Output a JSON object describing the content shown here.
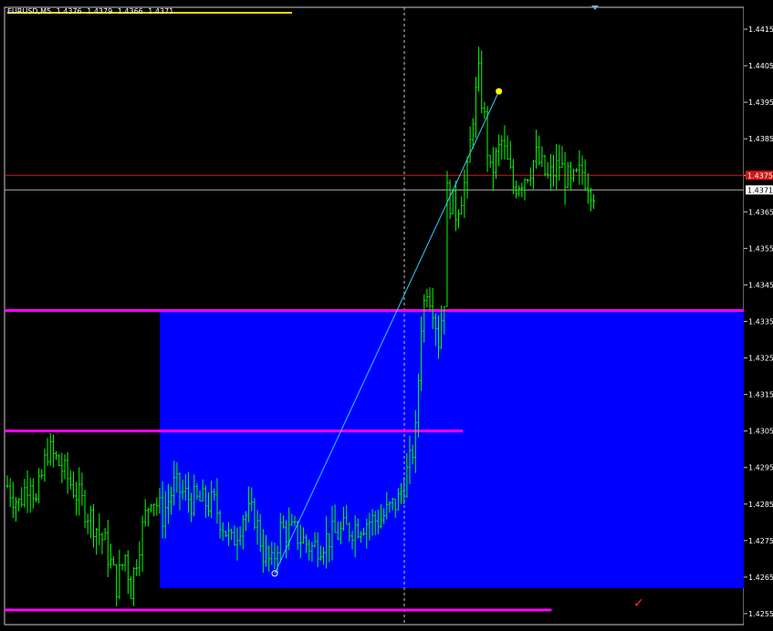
{
  "header": {
    "symbol": "EURUSD,M5",
    "ohlc": [
      "1.4376",
      "1.4379",
      "1.4366",
      "1.4371"
    ]
  },
  "icons": {
    "checkmark": "check-icon",
    "scroll_marker": "triangle-down-icon"
  },
  "colors": {
    "background": "#000000",
    "candles": "#00ff00",
    "zone_fill": "#0000ff",
    "level_lines": "#ff00ff",
    "trend_line": "#33ccff",
    "ask_line": "#d01818",
    "bid_line": "#b0b0b0",
    "header_line": "#ffd800"
  },
  "chart_data": {
    "type": "line",
    "ylim": [
      1.4252,
      1.4421
    ],
    "ticks": [
      "1.4415",
      "1.4405",
      "1.4395",
      "1.4385",
      "1.4375",
      "1.4365",
      "1.4355",
      "1.4345",
      "1.4335",
      "1.4325",
      "1.4315",
      "1.4305",
      "1.4295",
      "1.4285",
      "1.4275",
      "1.4265",
      "1.4255"
    ],
    "bars": 160,
    "price_path": [
      [
        0,
        1.429
      ],
      [
        4,
        1.4285
      ],
      [
        8,
        1.4293
      ],
      [
        10,
        1.4285
      ],
      [
        14,
        1.43
      ],
      [
        18,
        1.4296
      ],
      [
        24,
        1.4288
      ],
      [
        30,
        1.428
      ],
      [
        34,
        1.4274
      ],
      [
        38,
        1.4263
      ],
      [
        41,
        1.4271
      ],
      [
        43,
        1.4262
      ],
      [
        46,
        1.4275
      ],
      [
        50,
        1.4288
      ],
      [
        54,
        1.4282
      ],
      [
        58,
        1.429
      ],
      [
        64,
        1.4286
      ],
      [
        72,
        1.4285
      ],
      [
        78,
        1.4274
      ],
      [
        82,
        1.4282
      ],
      [
        86,
        1.4282
      ],
      [
        89,
        1.4272
      ],
      [
        92,
        1.4268
      ],
      [
        95,
        1.4278
      ],
      [
        100,
        1.4277
      ],
      [
        106,
        1.4273
      ],
      [
        112,
        1.4276
      ],
      [
        118,
        1.4278
      ],
      [
        124,
        1.428
      ],
      [
        130,
        1.4281
      ],
      [
        136,
        1.4286
      ],
      [
        140,
        1.4296
      ],
      [
        142,
        1.4304
      ],
      [
        144,
        1.4335
      ],
      [
        146,
        1.4345
      ],
      [
        148,
        1.434
      ],
      [
        150,
        1.433
      ],
      [
        152,
        1.4342
      ],
      [
        153,
        1.437
      ],
      [
        156,
        1.4365
      ],
      [
        160,
        1.4375
      ],
      [
        162,
        1.4392
      ],
      [
        164,
        1.4402
      ],
      [
        166,
        1.439
      ],
      [
        168,
        1.4375
      ],
      [
        172,
        1.4384
      ],
      [
        176,
        1.4372
      ],
      [
        180,
        1.4375
      ],
      [
        184,
        1.438
      ],
      [
        188,
        1.4374
      ],
      [
        192,
        1.4378
      ],
      [
        196,
        1.4372
      ],
      [
        200,
        1.4376
      ],
      [
        204,
        1.4371
      ]
    ],
    "ask_price": "1.4375",
    "bid_price": "1.4371",
    "levels": [
      {
        "price": 1.4338,
        "from": 0,
        "to": 1.0
      },
      {
        "price": 1.4305,
        "from": 0,
        "to": 0.62
      },
      {
        "price": 1.4256,
        "from": 0,
        "to": 0.74
      }
    ],
    "zone": {
      "top": 1.4338,
      "bottom": 1.4262,
      "from": 0.21,
      "to": 1.0
    },
    "trend": {
      "from_bar": 93,
      "from_price": 1.4266,
      "to_bar": 171,
      "to_price": 1.4398
    }
  }
}
